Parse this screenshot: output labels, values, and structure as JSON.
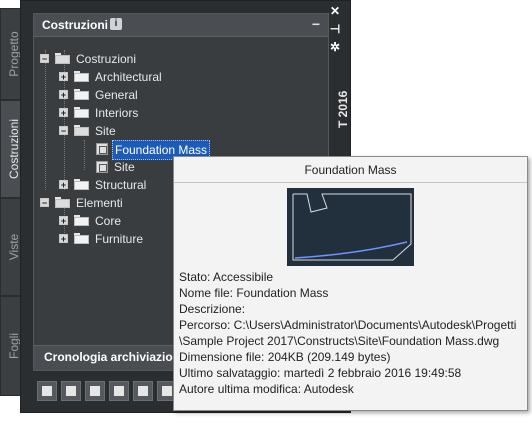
{
  "tabs": [
    {
      "label": "Progetto"
    },
    {
      "label": "Costruzioni"
    },
    {
      "label": "Viste"
    },
    {
      "label": "Fogli"
    }
  ],
  "header": {
    "title": "Costruzioni",
    "info_icon": "i"
  },
  "tree": {
    "root": "Costruzioni",
    "architectural": "Architectural",
    "general": "General",
    "interiors": "Interiors",
    "site": "Site",
    "foundation_mass": "Foundation Mass",
    "site_child": "Site",
    "structural": "Structural",
    "elementi": "Elementi",
    "core": "Core",
    "furniture": "Furniture"
  },
  "history": {
    "label": "Cronologia archiviazione"
  },
  "rail": {
    "title": "T 2016",
    "close": "✕",
    "pin": "⊣",
    "gear": "✲"
  },
  "tooltip": {
    "title": "Foundation Mass",
    "stato": "Stato: Accessibile",
    "nome": "Nome file: Foundation Mass",
    "descrizione": "Descrizione:",
    "percorso1": "Percorso: C:\\Users\\Administrator\\Documents\\Autodesk\\Progetti",
    "percorso2": "\\Sample Project 2017\\Constructs\\Site\\Foundation Mass.dwg",
    "dimensione": "Dimensione file: 204KB (209.149 bytes)",
    "salvataggio": "Ultimo salvataggio: martedì 2 febbraio 2016  19:49:58",
    "autore": "Autore ultima modifica: Autodesk"
  }
}
